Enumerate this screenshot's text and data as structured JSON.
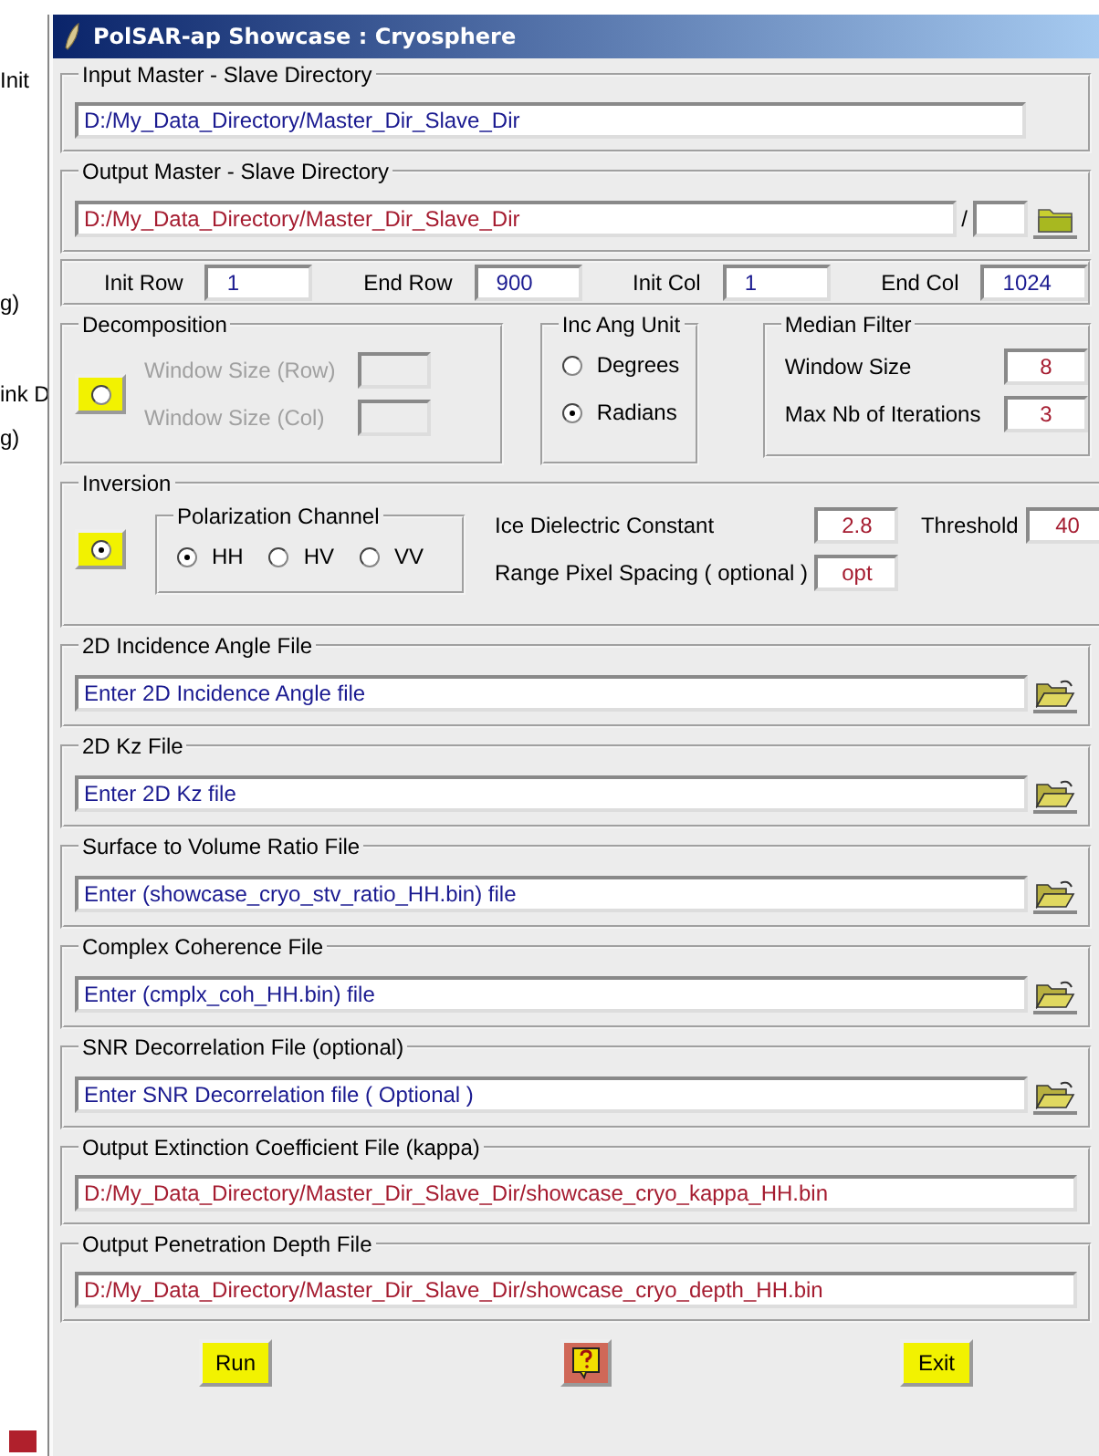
{
  "background_window": {
    "fragments": [
      {
        "text": "Init"
      },
      {
        "text": "g)"
      },
      {
        "text": "ink D"
      },
      {
        "text": "g)"
      }
    ]
  },
  "window": {
    "title": "PolSAR-ap Showcase : Cryosphere"
  },
  "input_directory": {
    "label": "Input Master - Slave Directory",
    "value": "D:/My_Data_Directory/Master_Dir_Slave_Dir",
    "kind": "input"
  },
  "output_directory": {
    "label": "Output Master - Slave Directory",
    "value": "D:/My_Data_Directory/Master_Dir_Slave_Dir",
    "kind": "output",
    "separator": "/"
  },
  "range": [
    {
      "label": "Init Row",
      "value": "1",
      "kind": "input"
    },
    {
      "label": "End Row",
      "value": "900",
      "kind": "input"
    },
    {
      "label": "Init Col",
      "value": "1",
      "kind": "input"
    },
    {
      "label": "End Col",
      "value": "1024",
      "kind": "input"
    }
  ],
  "decomposition": {
    "label": "Decomposition",
    "selected": false,
    "fields": [
      {
        "label": "Window Size (Row)",
        "disabled": true
      },
      {
        "label": "Window Size (Col)",
        "disabled": true
      }
    ]
  },
  "inc_ang_unit": {
    "label": "Inc Ang Unit",
    "options": [
      {
        "label": "Degrees",
        "selected": false
      },
      {
        "label": "Radians",
        "selected": true
      }
    ]
  },
  "median_filter": {
    "label": "Median Filter",
    "fields": [
      {
        "label": "Window Size",
        "value": "8"
      },
      {
        "label": "Max Nb of Iterations",
        "value": "3"
      }
    ]
  },
  "inversion": {
    "label": "Inversion",
    "selected": true,
    "polarization": {
      "label": "Polarization Channel",
      "options": [
        {
          "label": "HH",
          "selected": true
        },
        {
          "label": "HV",
          "selected": false
        },
        {
          "label": "VV",
          "selected": false
        }
      ]
    },
    "fields": [
      {
        "label": "Ice Dielectric Constant",
        "value": "2.8"
      },
      {
        "label": "Threshold",
        "value": "40"
      },
      {
        "label": "Range Pixel Spacing ( optional )",
        "value": "opt"
      }
    ]
  },
  "files": [
    {
      "label": "2D Incidence Angle File",
      "value": "Enter 2D Incidence Angle file",
      "kind": "input"
    },
    {
      "label": "2D Kz File",
      "value": "Enter 2D Kz file",
      "kind": "input"
    },
    {
      "label": "Surface to Volume Ratio File",
      "value": "Enter (showcase_cryo_stv_ratio_HH.bin) file",
      "kind": "input"
    },
    {
      "label": "Complex Coherence File",
      "value": "Enter (cmplx_coh_HH.bin) file",
      "kind": "input"
    },
    {
      "label": "SNR Decorrelation File (optional)",
      "value": "Enter SNR Decorrelation file ( Optional )",
      "kind": "input"
    },
    {
      "label": "Output Extinction Coefficient File (kappa)",
      "value": "D:/My_Data_Directory/Master_Dir_Slave_Dir/showcase_cryo_kappa_HH.bin",
      "kind": "output"
    },
    {
      "label": "Output Penetration Depth File",
      "value": "D:/My_Data_Directory/Master_Dir_Slave_Dir/showcase_cryo_depth_HH.bin",
      "kind": "output"
    }
  ],
  "buttons": [
    {
      "kind": "text",
      "label": "Run"
    },
    {
      "kind": "help"
    },
    {
      "kind": "text",
      "label": "Exit"
    }
  ]
}
